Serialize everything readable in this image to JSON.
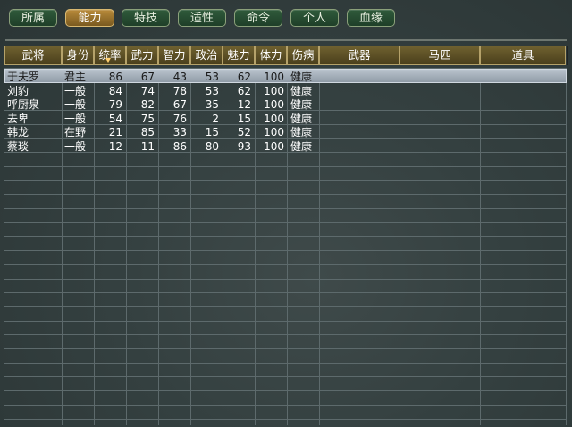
{
  "tabs": [
    {
      "label": "所属",
      "active": false
    },
    {
      "label": "能力",
      "active": true
    },
    {
      "label": "特技",
      "active": false
    },
    {
      "label": "适性",
      "active": false
    },
    {
      "label": "命令",
      "active": false
    },
    {
      "label": "个人",
      "active": false
    },
    {
      "label": "血缘",
      "active": false
    }
  ],
  "table": {
    "columns": [
      "武将",
      "身份",
      "统率",
      "武力",
      "智力",
      "政治",
      "魅力",
      "体力",
      "伤病",
      "武器",
      "马匹",
      "道具"
    ],
    "sorted_column": "统率",
    "selected_row": 0,
    "rows": [
      [
        "于夫罗",
        "君主",
        "86",
        "67",
        "43",
        "53",
        "62",
        "100",
        "健康",
        "",
        "",
        ""
      ],
      [
        "刘豹",
        "一般",
        "84",
        "74",
        "78",
        "53",
        "62",
        "100",
        "健康",
        "",
        "",
        ""
      ],
      [
        "呼厨泉",
        "一般",
        "79",
        "82",
        "67",
        "35",
        "12",
        "100",
        "健康",
        "",
        "",
        ""
      ],
      [
        "去卑",
        "一般",
        "54",
        "75",
        "76",
        "2",
        "15",
        "100",
        "健康",
        "",
        "",
        ""
      ],
      [
        "韩龙",
        "在野",
        "21",
        "85",
        "33",
        "15",
        "52",
        "100",
        "健康",
        "",
        "",
        ""
      ],
      [
        "蔡琰",
        "一般",
        "12",
        "11",
        "86",
        "80",
        "93",
        "100",
        "健康",
        "",
        "",
        ""
      ]
    ]
  },
  "colors": {
    "tab_active": "#b88a3a",
    "tab_normal": "#2f5a3a",
    "header_bg": "#6f6130",
    "selected_row": "#b9c3cd",
    "grid_line": "#5d6a6c"
  }
}
